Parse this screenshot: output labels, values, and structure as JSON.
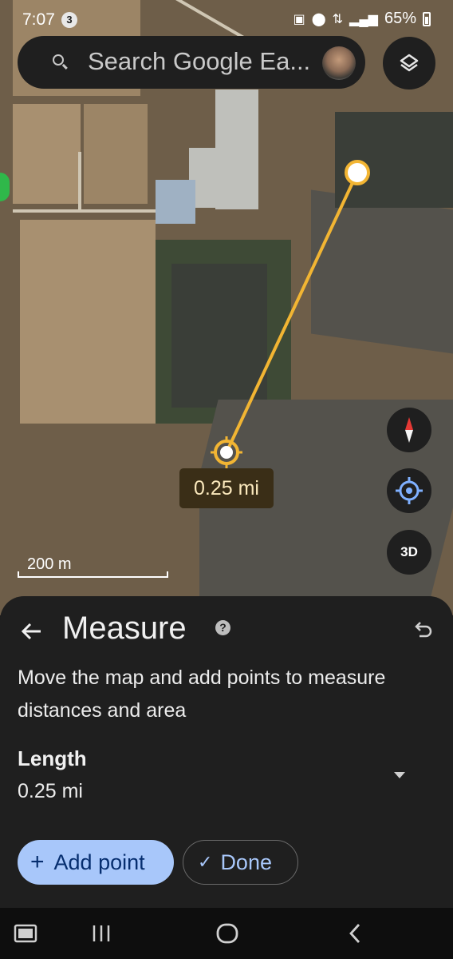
{
  "status_bar": {
    "time": "7:07",
    "notification_count": "3",
    "battery": "65%"
  },
  "search": {
    "placeholder": "Search Google Ea..."
  },
  "map": {
    "measurement_label": "0.25 mi",
    "scale_label": "200 m",
    "threed_label": "3D"
  },
  "sheet": {
    "title": "Measure",
    "help_glyph": "?",
    "instructions": "Move the map and add points to measure distances and area",
    "length_label": "Length",
    "length_value": "0.25 mi",
    "add_point_label": "Add point",
    "done_label": "Done"
  },
  "colors": {
    "accent": "#a8c7fa",
    "measure_line": "#f2b533",
    "sheet_bg": "#1f1f1f"
  },
  "icons": [
    "search-icon",
    "layers-icon",
    "compass-icon",
    "my-location-icon",
    "back-arrow-icon",
    "help-icon",
    "undo-icon",
    "chevron-down-icon",
    "plus-icon",
    "check-icon",
    "recent-apps-icon",
    "home-icon",
    "nav-back-icon",
    "screenshot-icon"
  ]
}
